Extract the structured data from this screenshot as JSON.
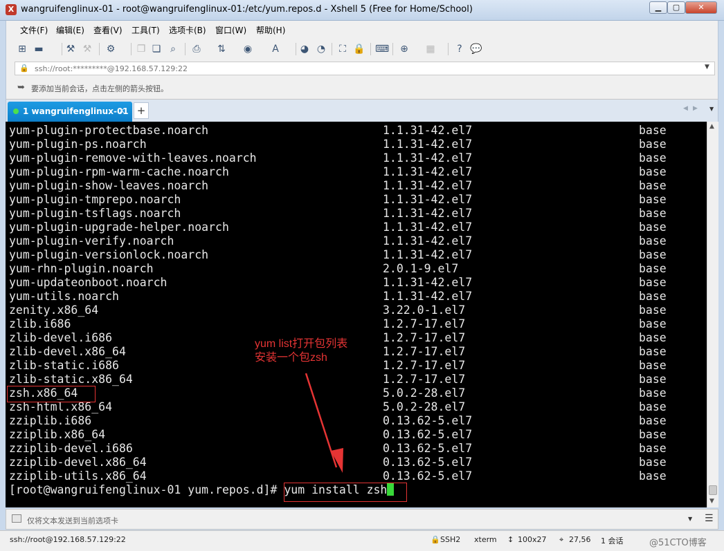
{
  "window": {
    "title": "wangruifenglinux-01 - root@wangruifenglinux-01:/etc/yum.repos.d - Xshell 5 (Free for Home/School)",
    "controls": [
      "▁",
      "▢",
      "✕"
    ]
  },
  "menu": [
    "文件(F)",
    "编辑(E)",
    "查看(V)",
    "工具(T)",
    "选项卡(B)",
    "窗口(W)",
    "帮助(H)"
  ],
  "address": {
    "text": "ssh://root:*********@192.168.57.129:22"
  },
  "hint": {
    "text": "要添加当前会话，点击左侧的箭头按钮。"
  },
  "tab": {
    "label": "1 wangruifenglinux-01",
    "close": "×",
    "new": "+"
  },
  "terminal": {
    "rows": [
      [
        "yum-plugin-protectbase.noarch",
        "1.1.31-42.el7",
        "base"
      ],
      [
        "yum-plugin-ps.noarch",
        "1.1.31-42.el7",
        "base"
      ],
      [
        "yum-plugin-remove-with-leaves.noarch",
        "1.1.31-42.el7",
        "base"
      ],
      [
        "yum-plugin-rpm-warm-cache.noarch",
        "1.1.31-42.el7",
        "base"
      ],
      [
        "yum-plugin-show-leaves.noarch",
        "1.1.31-42.el7",
        "base"
      ],
      [
        "yum-plugin-tmprepo.noarch",
        "1.1.31-42.el7",
        "base"
      ],
      [
        "yum-plugin-tsflags.noarch",
        "1.1.31-42.el7",
        "base"
      ],
      [
        "yum-plugin-upgrade-helper.noarch",
        "1.1.31-42.el7",
        "base"
      ],
      [
        "yum-plugin-verify.noarch",
        "1.1.31-42.el7",
        "base"
      ],
      [
        "yum-plugin-versionlock.noarch",
        "1.1.31-42.el7",
        "base"
      ],
      [
        "yum-rhn-plugin.noarch",
        "2.0.1-9.el7",
        "base"
      ],
      [
        "yum-updateonboot.noarch",
        "1.1.31-42.el7",
        "base"
      ],
      [
        "yum-utils.noarch",
        "1.1.31-42.el7",
        "base"
      ],
      [
        "zenity.x86_64",
        "3.22.0-1.el7",
        "base"
      ],
      [
        "zlib.i686",
        "1.2.7-17.el7",
        "base"
      ],
      [
        "zlib-devel.i686",
        "1.2.7-17.el7",
        "base"
      ],
      [
        "zlib-devel.x86_64",
        "1.2.7-17.el7",
        "base"
      ],
      [
        "zlib-static.i686",
        "1.2.7-17.el7",
        "base"
      ],
      [
        "zlib-static.x86_64",
        "1.2.7-17.el7",
        "base"
      ],
      [
        "zsh.x86_64",
        "5.0.2-28.el7",
        "base"
      ],
      [
        "zsh-html.x86_64",
        "5.0.2-28.el7",
        "base"
      ],
      [
        "zziplib.i686",
        "0.13.62-5.el7",
        "base"
      ],
      [
        "zziplib.x86_64",
        "0.13.62-5.el7",
        "base"
      ],
      [
        "zziplib-devel.i686",
        "0.13.62-5.el7",
        "base"
      ],
      [
        "zziplib-devel.x86_64",
        "0.13.62-5.el7",
        "base"
      ],
      [
        "zziplib-utils.x86_64",
        "0.13.62-5.el7",
        "base"
      ]
    ],
    "prompt": "[root@wangruifenglinux-01 yum.repos.d]# ",
    "command": "yum install zsh",
    "annotation": "yum list打开包列表\n安装一个包zsh",
    "annotation_color": "#e53434",
    "cursor_color": "#39d839"
  },
  "compose": {
    "placeholder": "仅将文本发送到当前选项卡"
  },
  "status": {
    "connection": "ssh://root@192.168.57.129:22",
    "protocol": "SSH2",
    "term": "xterm",
    "size": "100x27",
    "position": "27,56",
    "sessions": "1 会话",
    "watermark": "@51CTO博客"
  },
  "colors": {
    "tab_active": "#0d7fca",
    "terminal_bg": "#000000"
  }
}
